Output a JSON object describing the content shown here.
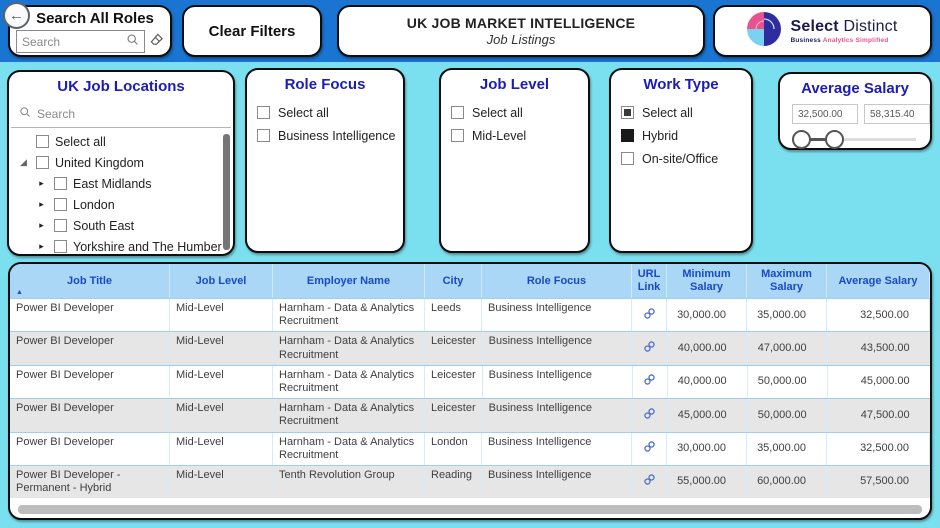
{
  "topbar": {
    "search_card": {
      "title": "Search All Roles",
      "placeholder": "Search"
    },
    "clear_filters_label": "Clear Filters",
    "title_card": {
      "title": "UK JOB MARKET INTELLIGENCE",
      "subtitle": "Job Listings"
    },
    "logo": {
      "brand_bold": "Select",
      "brand_regular": "Distinct",
      "tagline_left": "Business",
      "tagline_right": "Analytics Simplified"
    }
  },
  "filters": {
    "locations": {
      "title": "UK Job Locations",
      "search_placeholder": "Search",
      "items": [
        {
          "label": "Select all",
          "level": 0,
          "expander": "none",
          "state": "unchecked"
        },
        {
          "label": "United Kingdom",
          "level": 0,
          "expander": "expanded",
          "state": "unchecked"
        },
        {
          "label": "East Midlands",
          "level": 1,
          "expander": "collapsed",
          "state": "unchecked"
        },
        {
          "label": "London",
          "level": 1,
          "expander": "collapsed",
          "state": "unchecked"
        },
        {
          "label": "South East",
          "level": 1,
          "expander": "collapsed",
          "state": "unchecked"
        },
        {
          "label": "Yorkshire and The Humber",
          "level": 1,
          "expander": "collapsed",
          "state": "unchecked"
        }
      ]
    },
    "role_focus": {
      "title": "Role Focus",
      "options": [
        {
          "label": "Select all",
          "state": "unchecked"
        },
        {
          "label": "Business Intelligence",
          "state": "unchecked"
        }
      ]
    },
    "job_level": {
      "title": "Job Level",
      "options": [
        {
          "label": "Select all",
          "state": "unchecked"
        },
        {
          "label": "Mid-Level",
          "state": "unchecked"
        }
      ]
    },
    "work_type": {
      "title": "Work Type",
      "options": [
        {
          "label": "Select all",
          "state": "indeterminate"
        },
        {
          "label": "Hybrid",
          "state": "checked"
        },
        {
          "label": "On-site/Office",
          "state": "unchecked"
        }
      ]
    },
    "average_salary": {
      "title": "Average Salary",
      "min_value": "32,500.00",
      "max_value": "58,315.40"
    }
  },
  "table": {
    "columns": [
      "Job Title",
      "Job Level",
      "Employer Name",
      "City",
      "Role Focus",
      "URL Link",
      "Minimum Salary",
      "Maximum Salary",
      "Average Salary"
    ],
    "rows": [
      {
        "job_title": "Power BI Developer",
        "job_level": "Mid-Level",
        "employer": "Harnham - Data & Analytics Recruitment",
        "city": "Leeds",
        "role_focus": "Business Intelligence",
        "min_salary": "30,000.00",
        "max_salary": "35,000.00",
        "avg_salary": "32,500.00"
      },
      {
        "job_title": "Power BI Developer",
        "job_level": "Mid-Level",
        "employer": "Harnham - Data & Analytics Recruitment",
        "city": "Leicester",
        "role_focus": "Business Intelligence",
        "min_salary": "40,000.00",
        "max_salary": "47,000.00",
        "avg_salary": "43,500.00"
      },
      {
        "job_title": "Power BI Developer",
        "job_level": "Mid-Level",
        "employer": "Harnham - Data & Analytics Recruitment",
        "city": "Leicester",
        "role_focus": "Business Intelligence",
        "min_salary": "40,000.00",
        "max_salary": "50,000.00",
        "avg_salary": "45,000.00"
      },
      {
        "job_title": "Power BI Developer",
        "job_level": "Mid-Level",
        "employer": "Harnham - Data & Analytics Recruitment",
        "city": "Leicester",
        "role_focus": "Business Intelligence",
        "min_salary": "45,000.00",
        "max_salary": "50,000.00",
        "avg_salary": "47,500.00"
      },
      {
        "job_title": "Power BI Developer",
        "job_level": "Mid-Level",
        "employer": "Harnham - Data & Analytics Recruitment",
        "city": "London",
        "role_focus": "Business Intelligence",
        "min_salary": "30,000.00",
        "max_salary": "35,000.00",
        "avg_salary": "32,500.00"
      },
      {
        "job_title": "Power BI Developer - Permanent - Hybrid",
        "job_level": "Mid-Level",
        "employer": "Tenth Revolution Group",
        "city": "Reading",
        "role_focus": "Business Intelligence",
        "min_salary": "55,000.00",
        "max_salary": "60,000.00",
        "avg_salary": "57,500.00"
      }
    ]
  },
  "icons": {
    "back_arrow": "←",
    "sort_ascending": "▲",
    "tree_expanded": "◢",
    "tree_collapsed": "▸"
  },
  "colors": {
    "topbar_blue": "#1974D2",
    "canvas_cyan": "#7ADFEE",
    "card_title_navy": "#1C1CB8",
    "table_header_bg": "#A9D7F5",
    "table_header_text": "#1B49C4",
    "alt_row_gray": "#E6E6E6",
    "link_blue": "#4A6FD0",
    "logo_pink": "#E8538F",
    "logo_lightblue": "#7BD1F0",
    "logo_navy": "#2D2D9F"
  }
}
